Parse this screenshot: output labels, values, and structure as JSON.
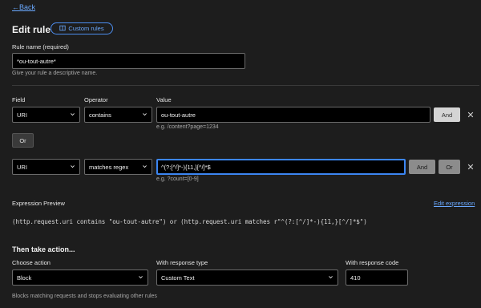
{
  "nav": {
    "back_label": "Back",
    "back_arrow": "←"
  },
  "header": {
    "title": "Edit rule",
    "custom_rules_label": "Custom rules"
  },
  "rule_name": {
    "label": "Rule name (required)",
    "value": "*ou-tout-autre*",
    "hint": "Give your rule a descriptive name."
  },
  "columns": {
    "field": "Field",
    "operator": "Operator",
    "value": "Value"
  },
  "conditions": [
    {
      "field": "URI",
      "operator": "contains",
      "value": "ou-tout-autre",
      "example": "e.g. /content?page=1234",
      "and_label": "And",
      "remove_icon": "close-icon"
    },
    {
      "field": "URI",
      "operator": "matches regex",
      "value": "^(?:[^/]*-){11,}[^/]*$",
      "example": "e.g. ?count=[0-9]",
      "and_label": "And",
      "or_label": "Or",
      "remove_icon": "close-icon"
    }
  ],
  "or_button_label": "Or",
  "expression": {
    "label": "Expression Preview",
    "edit_link": "Edit expression",
    "text": "(http.request.uri contains \"ou-tout-autre\") or (http.request.uri matches r\"^(?:[^/]*-){11,}[^/]*$\")"
  },
  "action": {
    "heading": "Then take action...",
    "choose_label": "Choose action",
    "choose_value": "Block",
    "response_type_label": "With response type",
    "response_type_value": "Custom Text",
    "response_code_label": "With response code",
    "response_code_value": "410",
    "hint": "Blocks matching requests and stops evaluating other rules"
  },
  "colors": {
    "accent": "#3c86f2",
    "link": "#6aa9ff",
    "background": "#1d1d1d"
  }
}
